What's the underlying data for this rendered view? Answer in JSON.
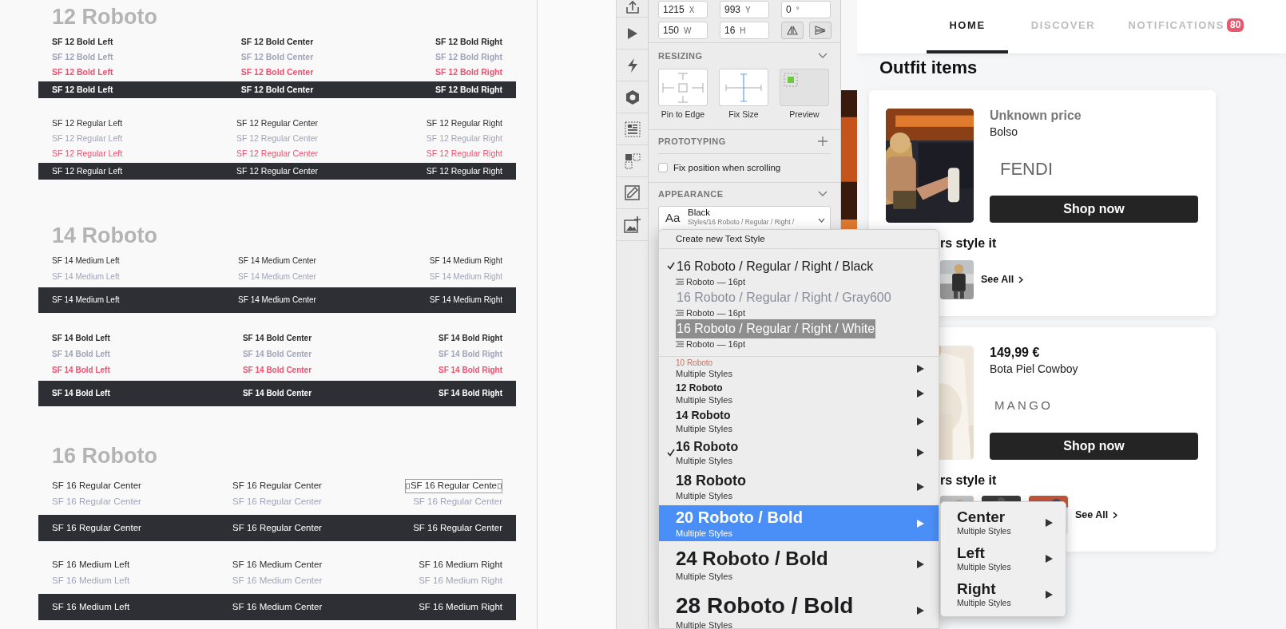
{
  "canvas": {
    "sections": [
      {
        "title": "12 Roboto",
        "groups": [
          {
            "rows": [
              {
                "kind": "text",
                "color": "#2b2b2b",
                "cells": [
                  {
                    "text": "SF 12 Bold Left",
                    "selected": false
                  },
                  {
                    "text": "SF 12 Bold Center",
                    "selected": false
                  },
                  {
                    "text": "SF 12 Bold Right",
                    "selected": false
                  }
                ]
              },
              {
                "kind": "text",
                "color": "#a0a4b8",
                "cells": [
                  {
                    "text": "SF 12 Bold Left",
                    "selected": false
                  },
                  {
                    "text": "SF 12 Bold Center",
                    "selected": false
                  },
                  {
                    "text": "SF 12 Bold Right",
                    "selected": false
                  }
                ]
              },
              {
                "kind": "text",
                "color": "#f0506e",
                "cells": [
                  {
                    "text": "SF 12 Bold Left",
                    "selected": false
                  },
                  {
                    "text": "SF 12 Bold Center",
                    "selected": false
                  },
                  {
                    "text": "SF 12 Bold Right",
                    "selected": false
                  }
                ]
              },
              {
                "kind": "bar",
                "cells": [
                  {
                    "text": "SF 12 Bold Left",
                    "selected": false
                  },
                  {
                    "text": "SF 12 Bold Center",
                    "selected": false
                  },
                  {
                    "text": "SF 12 Bold Right",
                    "selected": false
                  }
                ]
              }
            ]
          },
          {
            "rows": [
              {
                "kind": "text",
                "color": "#2b2b2b",
                "cells": [
                  {
                    "text": "SF 12 Regular Left",
                    "selected": false
                  },
                  {
                    "text": "SF 12 Regular Center",
                    "selected": false
                  },
                  {
                    "text": "SF 12 Regular Right",
                    "selected": false
                  }
                ]
              },
              {
                "kind": "text",
                "color": "#a0a4b8",
                "cells": [
                  {
                    "text": "SF 12 Regular Left",
                    "selected": false
                  },
                  {
                    "text": "SF 12 Regular Center",
                    "selected": false
                  },
                  {
                    "text": "SF 12 Regular Right",
                    "selected": false
                  }
                ]
              },
              {
                "kind": "text",
                "color": "#f0506e",
                "cells": [
                  {
                    "text": "SF 12 Regular Left",
                    "selected": false
                  },
                  {
                    "text": "SF 12 Regular Center",
                    "selected": false
                  },
                  {
                    "text": "SF 12 Regular Right",
                    "selected": false
                  }
                ]
              },
              {
                "kind": "bar",
                "cells": [
                  {
                    "text": "SF 12 Regular Left",
                    "selected": false
                  },
                  {
                    "text": "SF 12 Regular Center",
                    "selected": false
                  },
                  {
                    "text": "SF 12 Regular Right",
                    "selected": false
                  }
                ]
              }
            ]
          }
        ]
      },
      {
        "title": "14 Roboto",
        "groups": [
          {
            "rows": [
              {
                "kind": "text",
                "color": "#2b2b2b",
                "cells": [
                  {
                    "text": "SF 14 Medium Left",
                    "selected": false
                  },
                  {
                    "text": "SF 14 Medium Center",
                    "selected": false
                  },
                  {
                    "text": "SF 14 Medium Right",
                    "selected": false
                  }
                ]
              },
              {
                "kind": "text",
                "color": "#a0a4b8",
                "cells": [
                  {
                    "text": "SF 14 Medium Left",
                    "selected": false
                  },
                  {
                    "text": "SF 14 Medium Center",
                    "selected": false
                  },
                  {
                    "text": "SF 14 Medium Right",
                    "selected": false
                  }
                ]
              },
              {
                "kind": "bar",
                "cells": [
                  {
                    "text": "SF 14 Medium Left",
                    "selected": false
                  },
                  {
                    "text": "SF 14 Medium Center",
                    "selected": false
                  },
                  {
                    "text": "SF 14 Medium Right",
                    "selected": false
                  }
                ]
              }
            ]
          },
          {
            "rows": [
              {
                "kind": "text",
                "color": "#2b2b2b",
                "cells": [
                  {
                    "text": "SF 14 Bold Left",
                    "selected": false
                  },
                  {
                    "text": "SF 14 Bold Center",
                    "selected": false
                  },
                  {
                    "text": "SF 14 Bold Right",
                    "selected": false
                  }
                ]
              },
              {
                "kind": "text",
                "color": "#a0a4b8",
                "cells": [
                  {
                    "text": "SF 14 Bold Left",
                    "selected": false
                  },
                  {
                    "text": "SF 14 Bold Center",
                    "selected": false
                  },
                  {
                    "text": "SF 14 Bold Right",
                    "selected": false
                  }
                ]
              },
              {
                "kind": "text",
                "color": "#f0506e",
                "cells": [
                  {
                    "text": "SF 14 Bold Left",
                    "selected": false
                  },
                  {
                    "text": "SF 14 Bold Center",
                    "selected": false
                  },
                  {
                    "text": "SF 14 Bold Right",
                    "selected": false
                  }
                ]
              },
              {
                "kind": "bar",
                "cells": [
                  {
                    "text": "SF 14 Bold Left",
                    "selected": false
                  },
                  {
                    "text": "SF 14 Bold Center",
                    "selected": false
                  },
                  {
                    "text": "SF 14 Bold Right",
                    "selected": false
                  }
                ]
              }
            ]
          }
        ]
      },
      {
        "title": "16 Roboto",
        "groups": [
          {
            "rows": [
              {
                "kind": "text",
                "color": "#2b2b2b",
                "cells": [
                  {
                    "text": "SF 16 Regular Center",
                    "selected": false
                  },
                  {
                    "text": "SF 16 Regular Center",
                    "selected": false
                  },
                  {
                    "text": "SF 16 Regular Cente",
                    "selected": true
                  }
                ]
              },
              {
                "kind": "text",
                "color": "#a0a4b8",
                "cells": [
                  {
                    "text": "SF 16 Regular Center",
                    "selected": false
                  },
                  {
                    "text": "SF 16 Regular Center",
                    "selected": false
                  },
                  {
                    "text": "SF 16 Regular Center",
                    "selected": false
                  }
                ]
              },
              {
                "kind": "bar",
                "cells": [
                  {
                    "text": "SF 16 Regular Center",
                    "selected": false
                  },
                  {
                    "text": "SF 16 Regular Center",
                    "selected": false
                  },
                  {
                    "text": "SF 16 Regular Center",
                    "selected": false
                  }
                ]
              }
            ]
          },
          {
            "rows": [
              {
                "kind": "text",
                "color": "#2b2b2b",
                "cells": [
                  {
                    "text": "SF 16 Medium Left",
                    "selected": false
                  },
                  {
                    "text": "SF 16 Medium Center",
                    "selected": false
                  },
                  {
                    "text": "SF 16 Medium Right",
                    "selected": false
                  }
                ]
              },
              {
                "kind": "text",
                "color": "#a0a4b8",
                "cells": [
                  {
                    "text": "SF 16 Medium Left",
                    "selected": false
                  },
                  {
                    "text": "SF 16 Medium Center",
                    "selected": false
                  },
                  {
                    "text": "SF 16 Medium Right",
                    "selected": false
                  }
                ]
              },
              {
                "kind": "bar",
                "cells": [
                  {
                    "text": "SF 16 Medium Left",
                    "selected": false
                  },
                  {
                    "text": "SF 16 Medium Center",
                    "selected": false
                  },
                  {
                    "text": "SF 16 Medium Right",
                    "selected": false
                  }
                ]
              }
            ]
          }
        ]
      }
    ]
  },
  "inspector": {
    "position_fields": [
      {
        "value": "1215",
        "label": "X"
      },
      {
        "value": "993",
        "label": "Y"
      },
      {
        "value": "0",
        "label": "°"
      }
    ],
    "size_fields": [
      {
        "value": "150",
        "label": "W"
      },
      {
        "value": "16",
        "label": "H"
      }
    ],
    "resizing": {
      "title": "RESIZING",
      "options": [
        {
          "kind": "pin",
          "label": "Pin to Edge"
        },
        {
          "kind": "fix",
          "label": "Fix Size"
        },
        {
          "kind": "preview",
          "label": "Preview"
        }
      ]
    },
    "prototyping": {
      "title": "PROTOTYPING",
      "checkbox": {
        "label": "Fix position when scrolling",
        "checked": false
      }
    },
    "appearance": {
      "title": "APPEARANCE",
      "style_picker": {
        "glyph": "Aa",
        "name": "Black",
        "path": "Styles/16 Roboto / Regular / Right /"
      }
    }
  },
  "style_menu": {
    "create": "Create new Text Style",
    "styles": [
      {
        "name": "16 Roboto / Regular / Right / Black",
        "font": "Roboto — 16pt",
        "checked": true,
        "selected": false,
        "color": "#1d1d1f"
      },
      {
        "name": "16 Roboto / Regular / Right / Gray600",
        "font": "Roboto — 16pt",
        "checked": false,
        "selected": false,
        "color": "#8a8d9c"
      },
      {
        "name": "16 Roboto / Regular / Right / White",
        "font": "Roboto — 16pt",
        "checked": false,
        "selected": true,
        "color": "#ffffff"
      }
    ],
    "groups": [
      {
        "name": "10 Roboto",
        "subtitle": "Multiple Styles",
        "checked": false,
        "selected": false,
        "color": "#c0735f"
      },
      {
        "name": "12 Roboto",
        "subtitle": "Multiple Styles",
        "checked": false,
        "selected": false,
        "color": "#1d1d1f"
      },
      {
        "name": "14 Roboto",
        "subtitle": "Multiple Styles",
        "checked": false,
        "selected": false,
        "color": "#1d1d1f"
      },
      {
        "name": "16 Roboto",
        "subtitle": "Multiple Styles",
        "checked": true,
        "selected": false,
        "color": "#1d1d1f"
      },
      {
        "name": "18 Roboto",
        "subtitle": "Multiple Styles",
        "checked": false,
        "selected": false,
        "color": "#1d1d1f"
      },
      {
        "name": "20 Roboto / Bold",
        "subtitle": "Multiple Styles",
        "checked": false,
        "selected": true,
        "color": "#ffffff"
      },
      {
        "name": "24 Roboto / Bold",
        "subtitle": "Multiple Styles",
        "checked": false,
        "selected": false,
        "color": "#1d1d1f"
      },
      {
        "name": "28 Roboto / Bold",
        "subtitle": "Multiple Styles",
        "checked": false,
        "selected": false,
        "color": "#1d1d1f"
      }
    ]
  },
  "submenu": {
    "items": [
      {
        "name": "Center",
        "subtitle": "Multiple Styles"
      },
      {
        "name": "Left",
        "subtitle": "Multiple Styles"
      },
      {
        "name": "Right",
        "subtitle": "Multiple Styles"
      }
    ]
  },
  "app": {
    "tabs": [
      {
        "label": "HOME",
        "selected": true
      },
      {
        "label": "DISCOVER",
        "selected": false
      },
      {
        "label": "NOTIFICATIONS",
        "selected": false,
        "badge": "80"
      }
    ],
    "heading": "Outfit items",
    "cards": [
      {
        "price": "Unknown price",
        "price_muted": true,
        "product": "Bolso",
        "brand": {
          "text": "FENDI",
          "kind": "plain"
        },
        "button": "Shop now",
        "others_heading": "rs style it",
        "see_all": "See All"
      },
      {
        "price": "149,99 €",
        "price_muted": false,
        "product": "Bota Piel Cowboy",
        "brand": {
          "text": "MANGO",
          "kind": "spaced"
        },
        "button": "Shop now",
        "others_heading": "rs style it",
        "see_all": "See All"
      }
    ]
  }
}
